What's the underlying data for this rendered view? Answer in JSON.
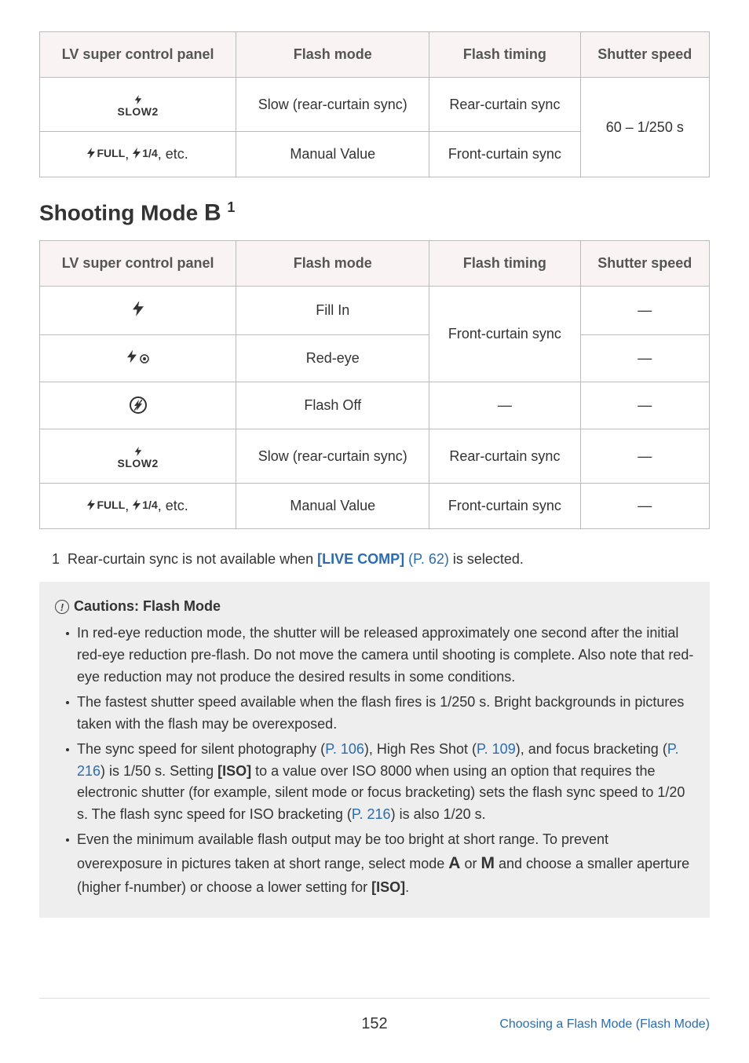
{
  "table1": {
    "headers": [
      "LV super control panel",
      "Flash mode",
      "Flash timing",
      "Shutter speed"
    ],
    "rows": [
      {
        "icon_label": "SLOW2",
        "mode": "Slow (rear-curtain sync)",
        "timing": "Rear-curtain sync"
      },
      {
        "icon_label_full": "FULL",
        "icon_label_quarter": "1/4",
        "etc": ", etc.",
        "mode": "Manual Value",
        "timing": "Front-curtain sync"
      }
    ],
    "shutter": "60 – 1/250 s"
  },
  "section_heading": "Shooting Mode ",
  "section_heading_mode": "B",
  "section_heading_sup": "1",
  "table2": {
    "headers": [
      "LV super control panel",
      "Flash mode",
      "Flash timing",
      "Shutter speed"
    ],
    "rows": [
      {
        "mode": "Fill In",
        "shutter": "—"
      },
      {
        "mode": "Red-eye",
        "shutter": "—"
      },
      {
        "mode": "Flash Off",
        "timing": "—",
        "shutter": "—"
      },
      {
        "icon_label": "SLOW2",
        "mode": "Slow (rear-curtain sync)",
        "timing": "Rear-curtain sync",
        "shutter": "—"
      },
      {
        "icon_label_full": "FULL",
        "icon_label_quarter": "1/4",
        "etc": ", etc.",
        "mode": "Manual Value",
        "timing": "Front-curtain sync",
        "shutter": "—"
      }
    ],
    "timing_front": "Front-curtain sync"
  },
  "footnote": {
    "num": "1",
    "text1": "Rear-curtain sync is not available when ",
    "link_label": "[LIVE COMP]",
    "link_page": " (P. 62)",
    "text2": " is selected."
  },
  "cautions": {
    "title": "Cautions: Flash Mode",
    "items": [
      {
        "text": "In red-eye reduction mode, the shutter will be released approximately one second after the initial red-eye reduction pre-flash. Do not move the camera until shooting is complete. Also note that red-eye reduction may not produce the desired results in some conditions."
      },
      {
        "text": "The fastest shutter speed available when the flash fires is 1/250 s. Bright backgrounds in pictures taken with the flash may be overexposed."
      },
      {
        "p1": "The sync speed for silent photography (",
        "l1": "P. 106",
        "p2": "), High Res Shot (",
        "l2": "P. 109",
        "p3": "), and focus bracketing (",
        "l3": "P. 216",
        "p4": ") is 1/50 s. Setting ",
        "iso1": "[ISO]",
        "p5": " to a value over ISO 8000 when using an option that requires the electronic shutter (for example, silent mode or focus bracketing) sets the flash sync speed to 1/20 s. The flash sync speed for ISO bracketing (",
        "l4": "P. 216",
        "p6": ") is also 1/20 s."
      },
      {
        "p1": "Even the minimum available flash output may be too bright at short range. To prevent overexposure in pictures taken at short range, select mode ",
        "m1": "A",
        "p2": " or ",
        "m2": "M",
        "p3": " and choose a smaller aperture (higher f-number) or choose a lower setting for ",
        "iso": "[ISO]",
        "p4": "."
      }
    ]
  },
  "footer": {
    "page": "152",
    "link": "Choosing a Flash Mode (Flash Mode)"
  }
}
